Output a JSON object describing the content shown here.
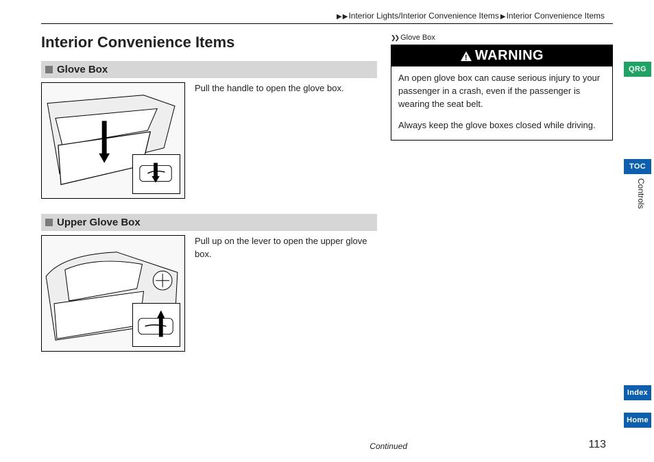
{
  "breadcrumb": {
    "path1": "Interior Lights/Interior Convenience Items",
    "path2": "Interior Convenience Items"
  },
  "page_title": "Interior Convenience Items",
  "sections": [
    {
      "title": "Glove Box",
      "text": "Pull the handle to open the glove box."
    },
    {
      "title": "Upper Glove Box",
      "text": "Pull up on the lever to open the upper glove box."
    }
  ],
  "sidebar": {
    "ref_label": "Glove Box",
    "warning_title": "WARNING",
    "warning_p1": "An open glove box can cause serious injury to your passenger in a crash, even if the passenger is wearing the seat belt.",
    "warning_p2": "Always keep the glove boxes closed while driving."
  },
  "footer": {
    "continued": "Continued",
    "page_number": "113"
  },
  "tabs": {
    "qrg": "QRG",
    "toc": "TOC",
    "controls": "Controls",
    "index": "Index",
    "home": "Home"
  }
}
